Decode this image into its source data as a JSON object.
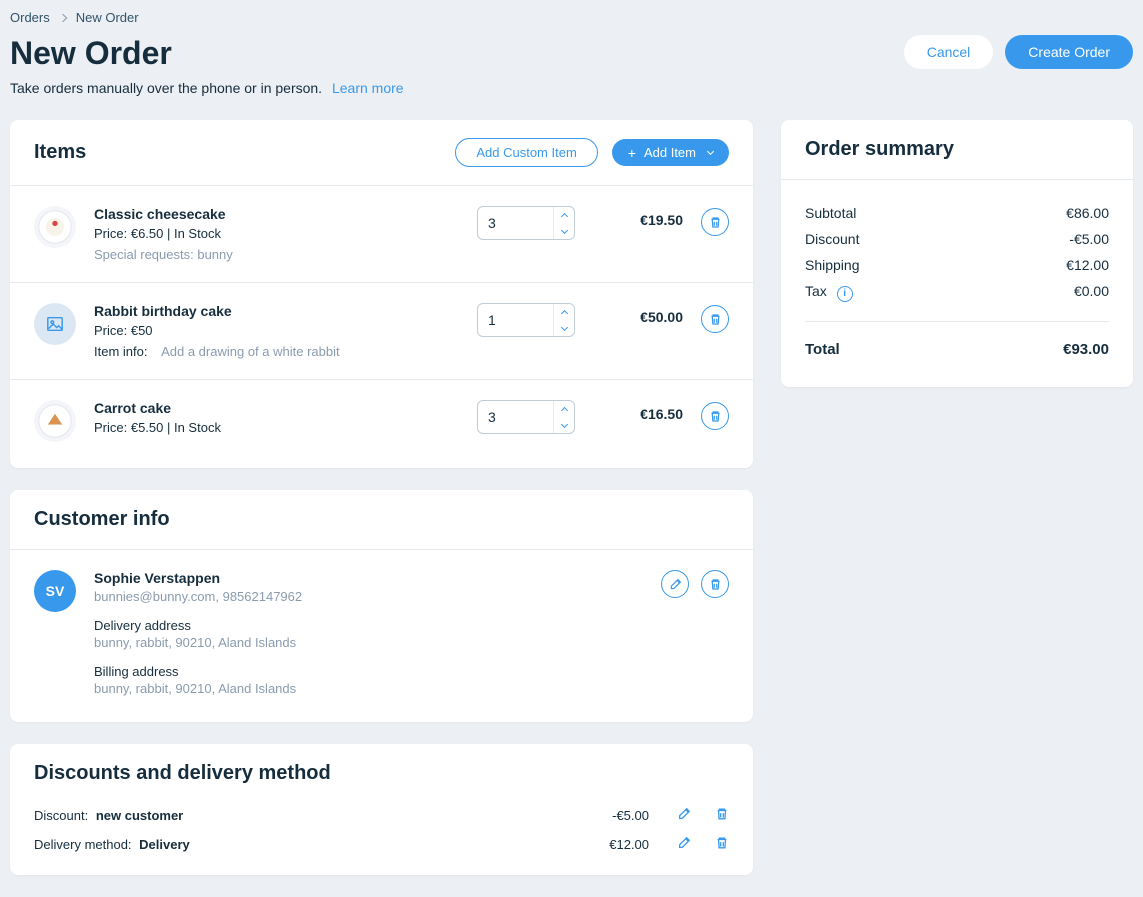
{
  "breadcrumb": {
    "parent": "Orders",
    "current": "New Order"
  },
  "page_title": "New Order",
  "subtitle": "Take orders manually over the phone or in person.",
  "learn_more": "Learn more",
  "buttons": {
    "cancel": "Cancel",
    "create": "Create Order"
  },
  "items_card": {
    "title": "Items",
    "add_custom": "Add Custom Item",
    "add_item": "Add Item",
    "items": [
      {
        "name": "Classic cheesecake",
        "price_line": "Price: €6.50  |  In Stock",
        "special_requests": "Special requests: bunny",
        "qty": "3",
        "total": "€19.50",
        "thumb_type": "cheesecake"
      },
      {
        "name": "Rabbit birthday cake",
        "price_line": "Price: €50",
        "item_info_label": "Item info:",
        "item_info_value": "Add a drawing of a white rabbit",
        "qty": "1",
        "total": "€50.00",
        "thumb_type": "placeholder"
      },
      {
        "name": "Carrot cake",
        "price_line": "Price: €5.50  |  In Stock",
        "qty": "3",
        "total": "€16.50",
        "thumb_type": "carrot"
      }
    ]
  },
  "customer_card": {
    "title": "Customer info",
    "initials": "SV",
    "name": "Sophie Verstappen",
    "contact": "bunnies@bunny.com, 98562147962",
    "delivery_label": "Delivery address",
    "delivery_value": "bunny, rabbit, 90210, Aland Islands",
    "billing_label": "Billing address",
    "billing_value": "bunny, rabbit, 90210, Aland Islands"
  },
  "discounts_card": {
    "title": "Discounts and delivery method",
    "discount_label": "Discount:",
    "discount_name": "new customer",
    "discount_amount": "-€5.00",
    "delivery_label": "Delivery method:",
    "delivery_name": "Delivery",
    "delivery_amount": "€12.00"
  },
  "summary_card": {
    "title": "Order summary",
    "rows": {
      "subtotal_label": "Subtotal",
      "subtotal_value": "€86.00",
      "discount_label": "Discount",
      "discount_value": "-€5.00",
      "shipping_label": "Shipping",
      "shipping_value": "€12.00",
      "tax_label": "Tax",
      "tax_value": "€0.00",
      "total_label": "Total",
      "total_value": "€93.00"
    }
  }
}
